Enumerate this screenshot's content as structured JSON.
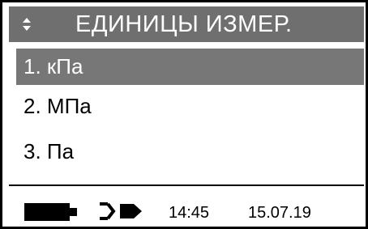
{
  "header": {
    "title": "ЕДИНИЦЫ ИЗМЕР.",
    "nav_icon": "up-down-arrows-icon"
  },
  "menu": {
    "items": [
      {
        "label": "1. кПа",
        "selected": true
      },
      {
        "label": "2. МПа",
        "selected": false
      },
      {
        "label": "3. Па",
        "selected": false
      }
    ]
  },
  "status_bar": {
    "battery_icon": "battery-icon",
    "power_icon": "power-plug-icon",
    "time": "14:45",
    "date": "15.07.19"
  },
  "colors": {
    "title_bg": "#6f6f6f",
    "selected_bg": "#777777",
    "text": "#000000",
    "inverse_text": "#ffffff"
  }
}
